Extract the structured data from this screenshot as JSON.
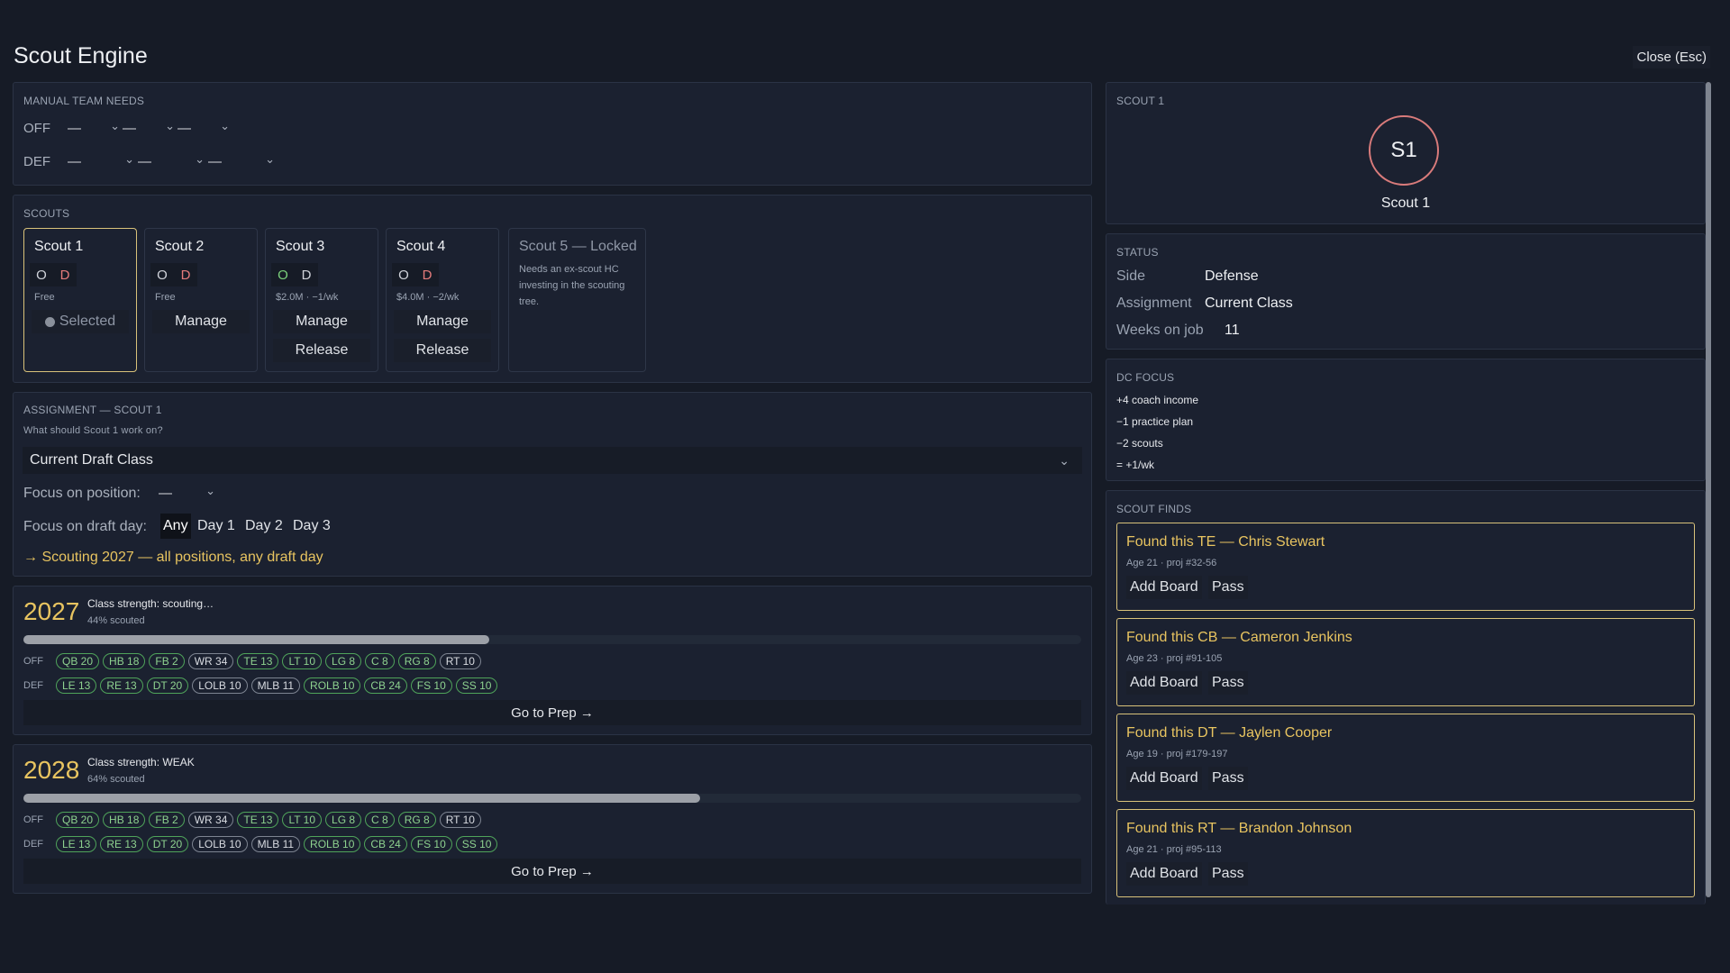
{
  "title": "Scout Engine",
  "close_label": "Close (Esc)",
  "team_needs": {
    "label": "MANUAL TEAM NEEDS",
    "off_label": "OFF",
    "def_label": "DEF",
    "off_values": [
      "—",
      "—",
      "—"
    ],
    "def_values": [
      "—",
      "—",
      "—"
    ]
  },
  "scouts": {
    "label": "SCOUTS",
    "cards": [
      {
        "name": "Scout 1",
        "o": "O",
        "d": "D",
        "sub": "Free",
        "btn": "Selected"
      },
      {
        "name": "Scout 2",
        "o": "O",
        "d": "D",
        "sub": "Free",
        "btn": "Manage"
      },
      {
        "name": "Scout 3",
        "o": "O",
        "d": "D",
        "sub": "$2.0M · −1/wk",
        "btn": "Manage",
        "btn2": "Release"
      },
      {
        "name": "Scout 4",
        "o": "O",
        "d": "D",
        "sub": "$4.0M · −2/wk",
        "btn": "Manage",
        "btn2": "Release"
      },
      {
        "name": "Scout 5 — Locked",
        "desc": "Needs an ex-scout HC investing in the scouting tree."
      }
    ]
  },
  "assignment": {
    "label": "ASSIGNMENT — SCOUT 1",
    "question": "What should Scout 1 work on?",
    "selected": "Current Draft Class",
    "focus_position_label": "Focus on position:",
    "focus_position_value": "—",
    "focus_day_label": "Focus on draft day:",
    "days": [
      "Any",
      "Day 1",
      "Day 2",
      "Day 3"
    ],
    "note": "→ Scouting 2027 — all positions, any draft day"
  },
  "classes": [
    {
      "year": "2027",
      "strength": "Class strength: scouting…",
      "scouted": "44% scouted",
      "progress": 0.44,
      "off_label": "OFF",
      "def_label": "DEF",
      "off": [
        "QB 20",
        "HB 18",
        "FB 2",
        "WR 34",
        "TE 13",
        "LT 10",
        "LG 8",
        "C 8",
        "RG 8",
        "RT 10"
      ],
      "def": [
        "LE 13",
        "RE 13",
        "DT 20",
        "LOLB 10",
        "MLB 11",
        "ROLB 10",
        "CB 24",
        "FS 10",
        "SS 10"
      ],
      "prep": "Go to Prep →"
    },
    {
      "year": "2028",
      "strength": "Class strength: WEAK",
      "scouted": "64% scouted",
      "progress": 0.64,
      "off_label": "OFF",
      "def_label": "DEF",
      "off": [
        "QB 20",
        "HB 18",
        "FB 2",
        "WR 34",
        "TE 13",
        "LT 10",
        "LG 8",
        "C 8",
        "RG 8",
        "RT 10"
      ],
      "def": [
        "LE 13",
        "RE 13",
        "DT 20",
        "LOLB 10",
        "MLB 11",
        "ROLB 10",
        "CB 24",
        "FS 10",
        "SS 10"
      ],
      "prep": "Go to Prep →"
    }
  ],
  "detail": {
    "label": "SCOUT 1",
    "initials": "S1",
    "name": "Scout 1",
    "status_label": "STATUS",
    "side_k": "Side",
    "side_v": "Defense",
    "assign_k": "Assignment",
    "assign_v": "Current Class",
    "weeks_k": "Weeks on job",
    "weeks_v": "11",
    "dc_label": "DC FOCUS",
    "dc_lines": [
      "+4 coach income",
      "−1 practice plan",
      "−2 scouts",
      "= +1/wk"
    ],
    "finds_label": "SCOUT FINDS",
    "finds": [
      {
        "title": "Found this TE — Chris Stewart",
        "sub": "Age 21 · proj #32-56",
        "add": "Add Board",
        "pass": "Pass"
      },
      {
        "title": "Found this CB — Cameron Jenkins",
        "sub": "Age 23 · proj #91-105",
        "add": "Add Board",
        "pass": "Pass"
      },
      {
        "title": "Found this DT — Jaylen Cooper",
        "sub": "Age 19 · proj #179-197",
        "add": "Add Board",
        "pass": "Pass"
      },
      {
        "title": "Found this RT — Brandon Johnson",
        "sub": "Age 21 · proj #95-113",
        "add": "Add Board",
        "pass": "Pass"
      }
    ]
  },
  "colors": {
    "accent": "#e8c460",
    "green": "#7bd07b",
    "red": "#e67c7c",
    "bg": "#161b26"
  }
}
